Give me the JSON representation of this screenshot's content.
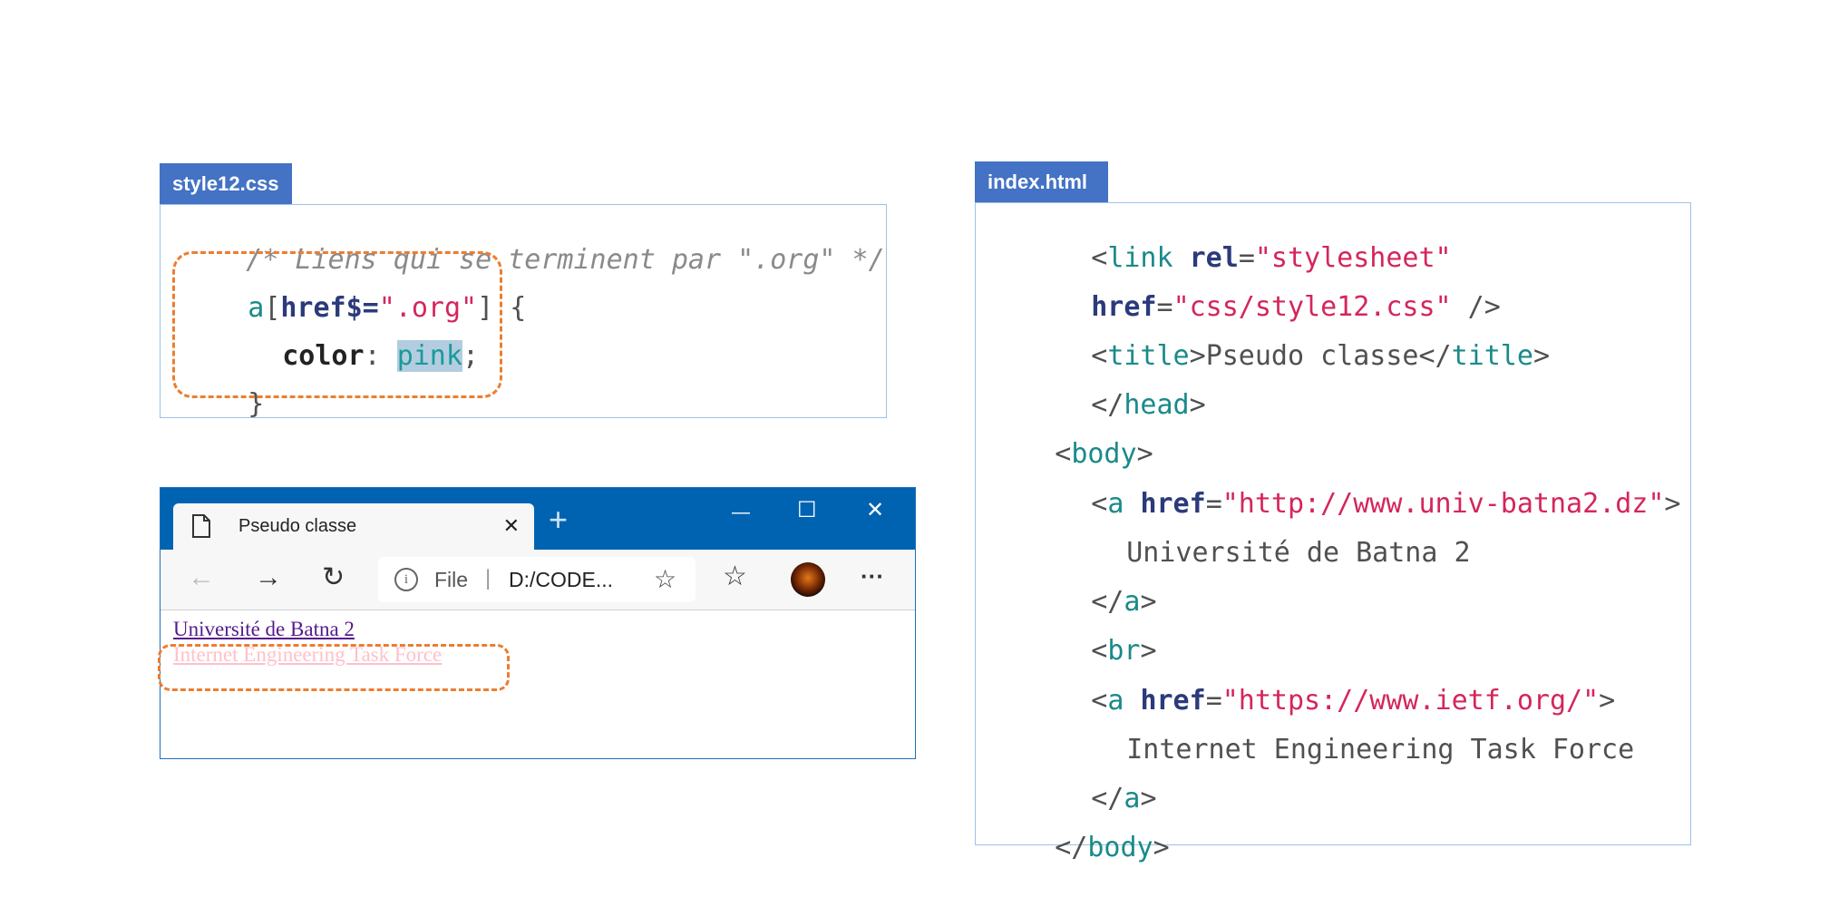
{
  "css_panel": {
    "file_name": "style12.css",
    "comment": "/* Liens qui se terminent par \".org\" */",
    "selector_tag": "a",
    "bracket_open": "[",
    "attr": "href$=",
    "attr_value": "\".org\"",
    "bracket_close": "] {",
    "property": "color",
    "colon": ": ",
    "value": "pink",
    "semicolon": ";",
    "closing": "}"
  },
  "html_panel": {
    "file_name": "index.html",
    "lines": {
      "l1_open": "<",
      "l1_tag": "link",
      "l1_attr": "rel",
      "l1_eq": "=",
      "l1_val": "\"stylesheet\"",
      "l2_attr": "href",
      "l2_eq": "=",
      "l2_val": "\"css/style12.css\"",
      "l2_end": " />",
      "l3_open": "<",
      "l3_tag": "title",
      "l3_close": ">",
      "l3_text": "Pseudo classe",
      "l3_end_open": "</",
      "l3_end_tag": "title",
      "l3_end_close": ">",
      "l4_open": "</",
      "l4_tag": "head",
      "l4_close": ">",
      "l5_open": "<",
      "l5_tag": "body",
      "l5_close": ">",
      "l6_open": "<",
      "l6_tag": "a",
      "l6_attr": "href",
      "l6_eq": "=",
      "l6_val": "\"http://www.univ-batna2.dz\"",
      "l6_close": ">",
      "l7_text": "Université de Batna 2",
      "l8_open": "</",
      "l8_tag": "a",
      "l8_close": ">",
      "l9_open": "<",
      "l9_tag": "br",
      "l9_close": ">",
      "l10_open": "<",
      "l10_tag": "a",
      "l10_attr": "href",
      "l10_eq": "=",
      "l10_val": "\"https://www.ietf.org/\"",
      "l10_close": ">",
      "l11_text": "Internet Engineering Task Force",
      "l12_open": "</",
      "l12_tag": "a",
      "l12_close": ">",
      "l13_open": "</",
      "l13_tag": "body",
      "l13_close": ">"
    }
  },
  "browser": {
    "tab_title": "Pseudo classe",
    "tab_close": "✕",
    "new_tab": "+",
    "minimize": "—",
    "maximize": "☐",
    "close": "✕",
    "address_prefix": "File",
    "address_separator": "|",
    "address_text": "D:/CODE...",
    "more": "···",
    "link1": "Université de Batna 2",
    "link2": "Internet Engineering Task Force",
    "link1_color": "#551a8b",
    "link2_color": "#ffc0cb"
  },
  "colors": {
    "tab_header": "#4472c4",
    "box_border": "#9dc3e6",
    "highlight_dash": "#ed7d31",
    "browser_titlebar": "#0063b1"
  }
}
